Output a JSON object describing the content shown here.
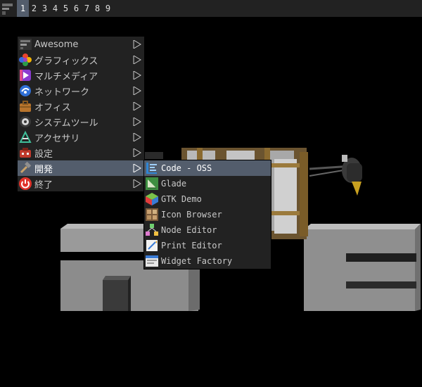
{
  "wibar": {
    "launcher_icon": "awesome-launcher-icon",
    "tags": [
      "1",
      "2",
      "3",
      "4",
      "5",
      "6",
      "7",
      "8",
      "9"
    ],
    "active_tag": "1"
  },
  "colors": {
    "bar_bg": "#222222",
    "focus_bg": "#535d6c",
    "menu_fg": "#c8c8c8",
    "focus_fg": "#ffffff"
  },
  "main_menu": {
    "items": [
      {
        "label": "Awesome",
        "icon": "awesome-icon"
      },
      {
        "label": "グラフィックス",
        "icon": "graphics-icon"
      },
      {
        "label": "マルチメディア",
        "icon": "multimedia-icon"
      },
      {
        "label": "ネットワーク",
        "icon": "network-icon"
      },
      {
        "label": "オフィス",
        "icon": "office-icon"
      },
      {
        "label": "システムツール",
        "icon": "system-tools-icon"
      },
      {
        "label": "アクセサリ",
        "icon": "accessories-icon"
      },
      {
        "label": "設定",
        "icon": "settings-icon"
      },
      {
        "label": "開発",
        "icon": "development-icon",
        "focused": true
      },
      {
        "label": "終了",
        "icon": "power-icon"
      }
    ]
  },
  "submenu_dev": {
    "items": [
      {
        "label": "Code - OSS",
        "icon": "code-oss-icon",
        "focused": true
      },
      {
        "label": "Glade",
        "icon": "glade-icon"
      },
      {
        "label": "GTK Demo",
        "icon": "gtk-demo-icon"
      },
      {
        "label": "Icon Browser",
        "icon": "icon-browser-icon"
      },
      {
        "label": "Node Editor",
        "icon": "node-editor-icon"
      },
      {
        "label": "Print Editor",
        "icon": "print-editor-icon"
      },
      {
        "label": "Widget Factory",
        "icon": "widget-factory-icon"
      }
    ]
  }
}
